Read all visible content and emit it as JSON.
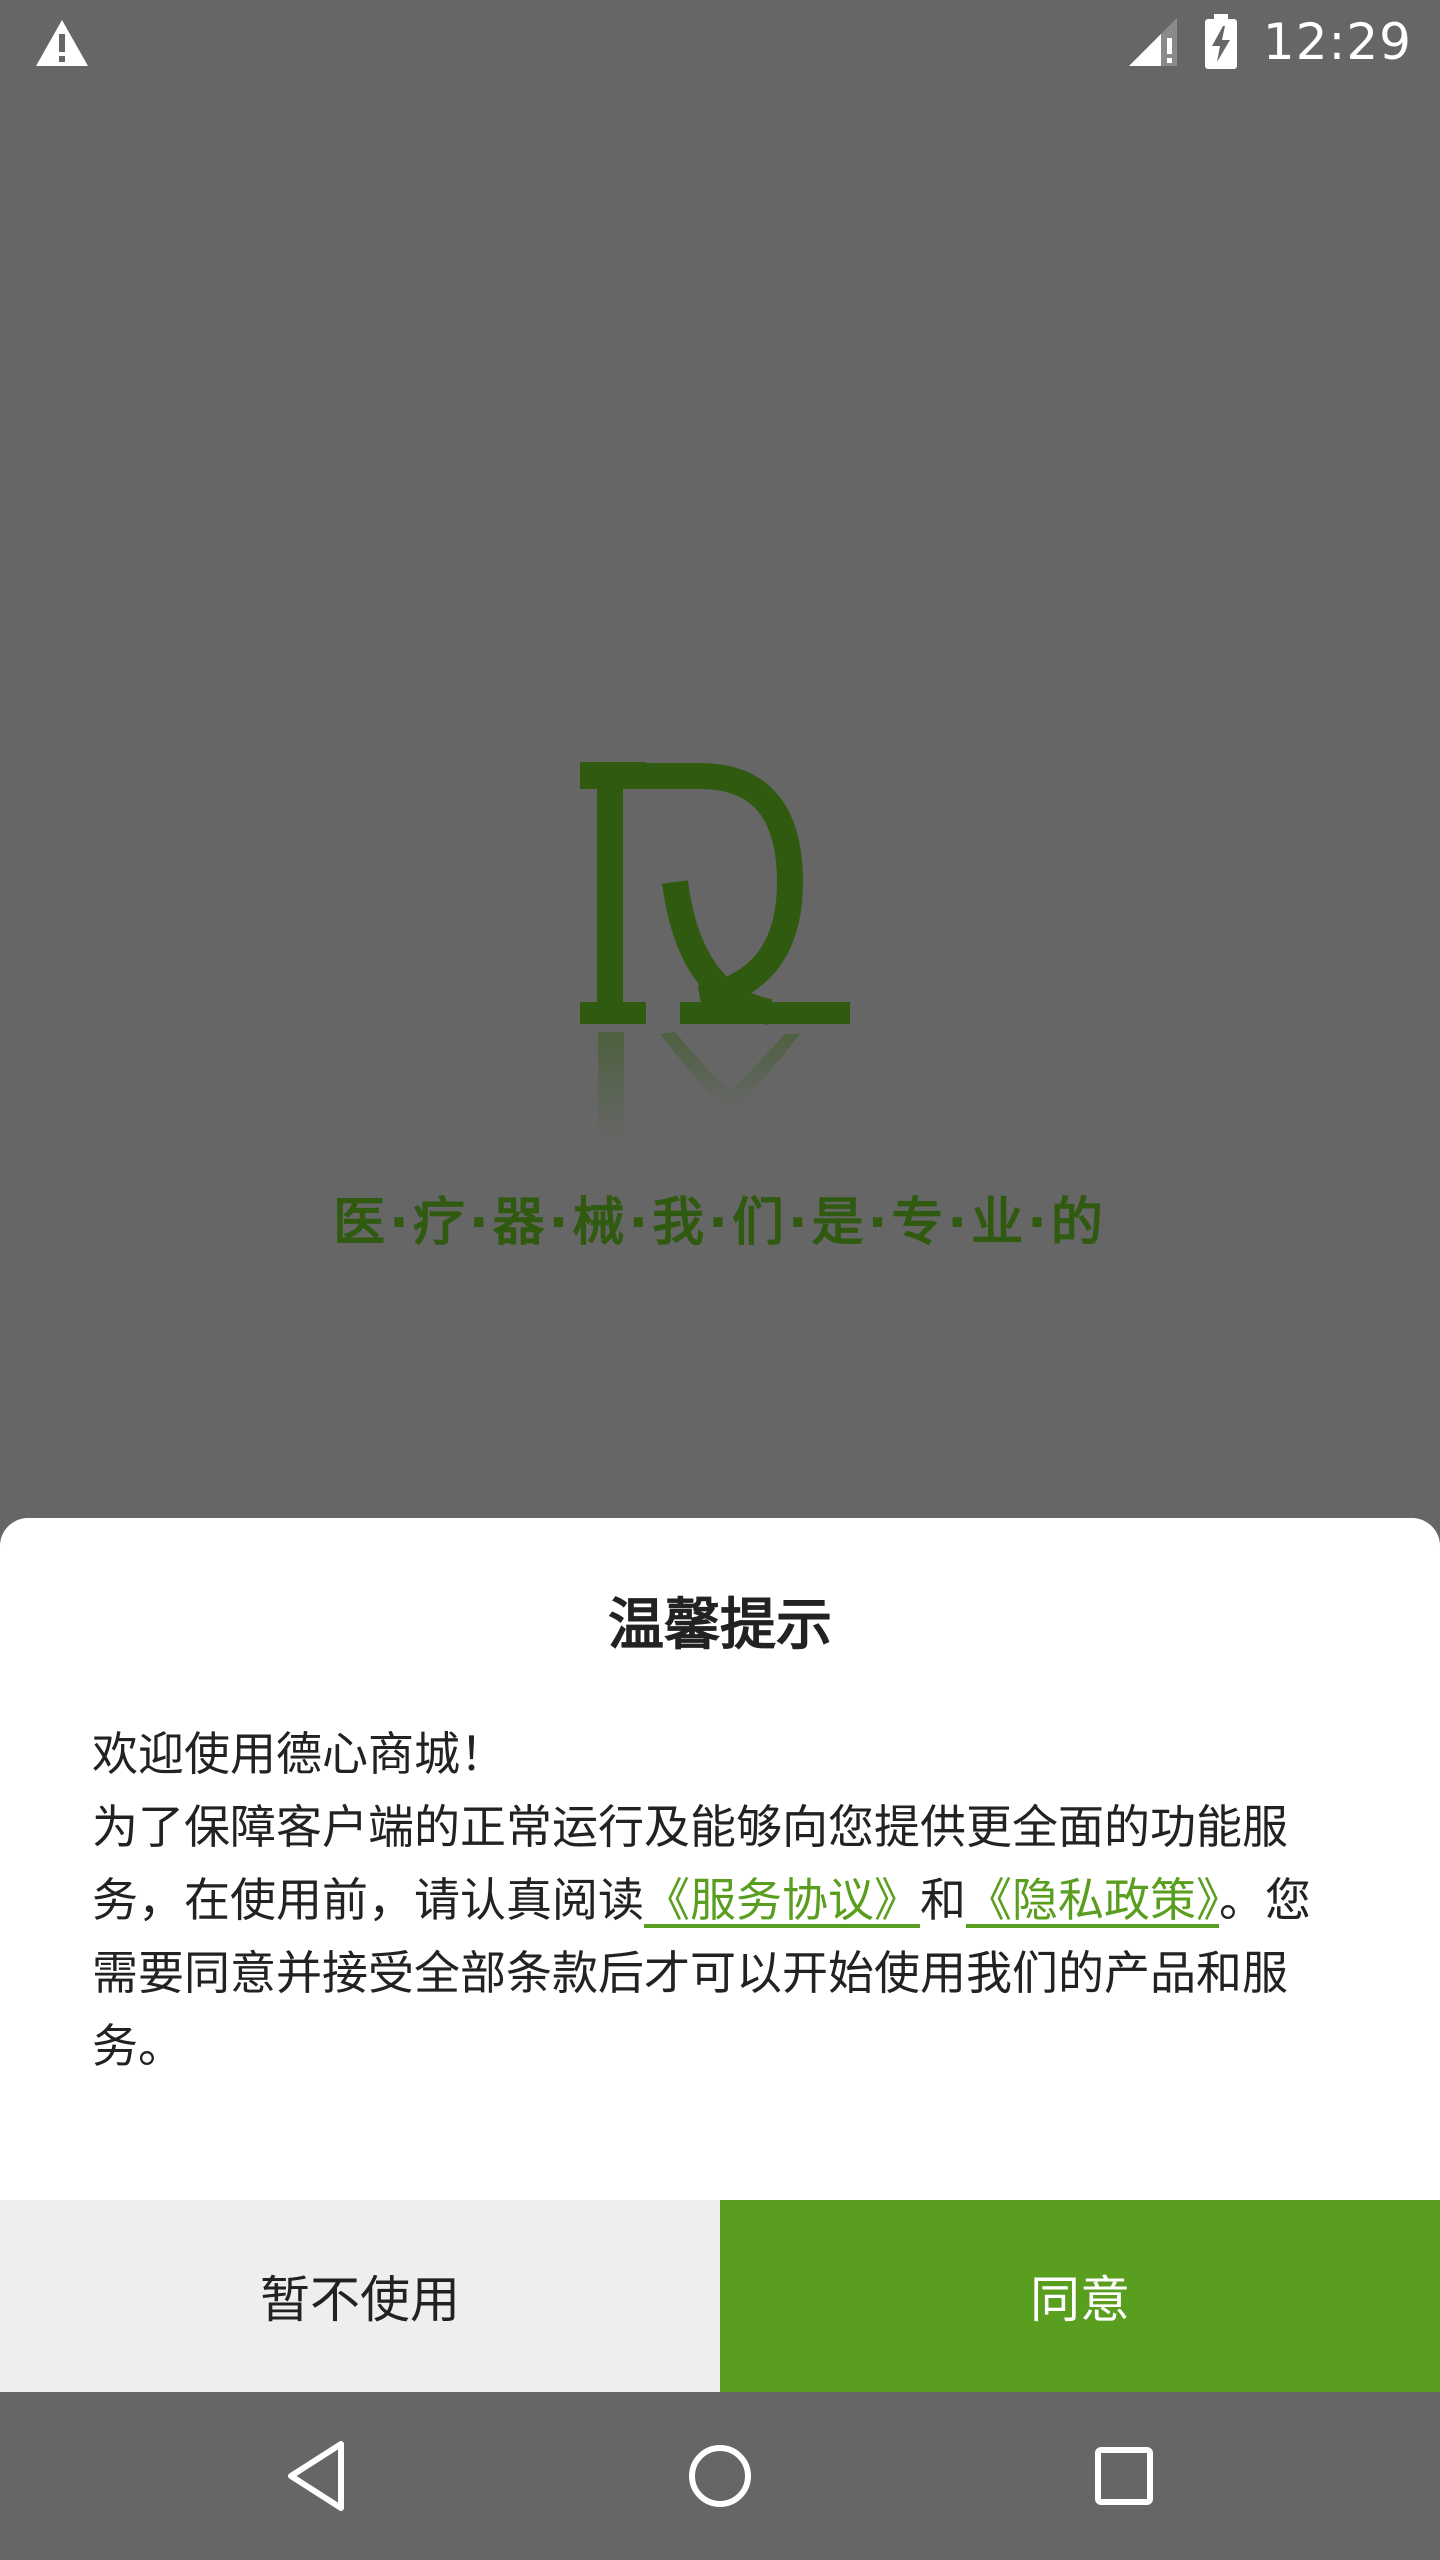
{
  "status_bar": {
    "time": "12:29",
    "icons": [
      "warning-icon",
      "signal-icon",
      "battery-charging-icon"
    ]
  },
  "splash": {
    "logo_icon": "dx-logo-icon",
    "slogan": "医·疗·器·械·我·们·是·专·业·的"
  },
  "dialog": {
    "title": "温馨提示",
    "greeting": "欢迎使用德心商城！",
    "body_prefix": "为了保障客户端的正常运行及能够向您提供更全面的功能服务，在使用前，请认真阅读",
    "service_link": "《服务协议》",
    "conjunction": "和",
    "privacy_link": "《隐私政策》",
    "body_suffix": "。您需要同意并接受全部条款后才可以开始使用我们的产品和服务。",
    "decline_label": "暂不使用",
    "agree_label": "同意"
  },
  "nav_bar": {
    "icons": [
      "back-icon",
      "home-icon",
      "recent-apps-icon"
    ]
  },
  "colors": {
    "accent": "#5a9e1f",
    "logo_green": "#2f5a10",
    "backdrop": "#666666"
  }
}
